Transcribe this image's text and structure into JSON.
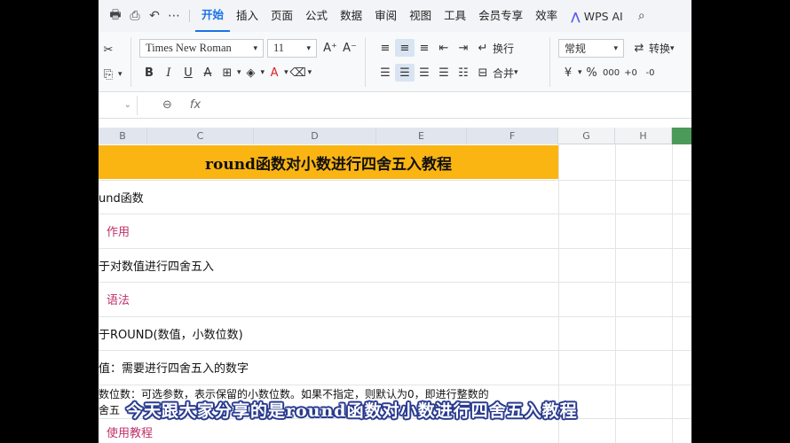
{
  "menubar": {
    "quick_icons": [
      "🖶",
      "⎙",
      "↶",
      "⋯"
    ],
    "tabs": [
      {
        "label": "开始",
        "active": true
      },
      {
        "label": "插入"
      },
      {
        "label": "页面"
      },
      {
        "label": "公式"
      },
      {
        "label": "数据"
      },
      {
        "label": "审阅"
      },
      {
        "label": "视图"
      },
      {
        "label": "工具"
      },
      {
        "label": "会员专享"
      },
      {
        "label": "效率"
      }
    ],
    "ai_label": "WPS AI",
    "search_icon": "search-icon"
  },
  "ribbon": {
    "font_name": "Times New Roman",
    "font_size": "11",
    "wrap_label": "换行",
    "merge_label": "合并",
    "number_format": "常规",
    "convert_label": "转换",
    "increase_font": "A⁺",
    "decrease_font": "A⁻",
    "bold": "B",
    "italic": "I",
    "underline": "U",
    "strike": "A",
    "currency": "¥",
    "percent": "%",
    "thousands": "000",
    "dec_inc": "+0",
    "dec_dec": "-0"
  },
  "formula_bar": {
    "zoom_icon": "⊖",
    "fx_label": "fx"
  },
  "columns": [
    "B",
    "C",
    "D",
    "E",
    "F",
    "G",
    "H"
  ],
  "sheet": {
    "title": "round函数对小数进行四舍五入教程",
    "rows": [
      {
        "text": "und函数",
        "style": "normal"
      },
      {
        "text": "作用",
        "style": "pink"
      },
      {
        "text": "于对数值进行四舍五入",
        "style": "normal"
      },
      {
        "text": "语法",
        "style": "pink"
      },
      {
        "text": "于ROUND(数值，小数位数)",
        "style": "normal"
      },
      {
        "text": "值：需要进行四舍五入的数字",
        "style": "normal"
      },
      {
        "text": "数位数：可选参数，表示保留的小数位数。如果不指定，则默认为0，即进行整数的",
        "style": "small"
      },
      {
        "text": "舍五",
        "style": "small"
      },
      {
        "text": "使用教程",
        "style": "pink"
      }
    ]
  },
  "caption": "今天跟大家分享的是round函数对小数进行四舍五入教程",
  "colors": {
    "title_fill": "#fbb512",
    "accent": "#1a73e8",
    "pink_text": "#c0306a",
    "caption_outline": "#2a3b8f"
  }
}
